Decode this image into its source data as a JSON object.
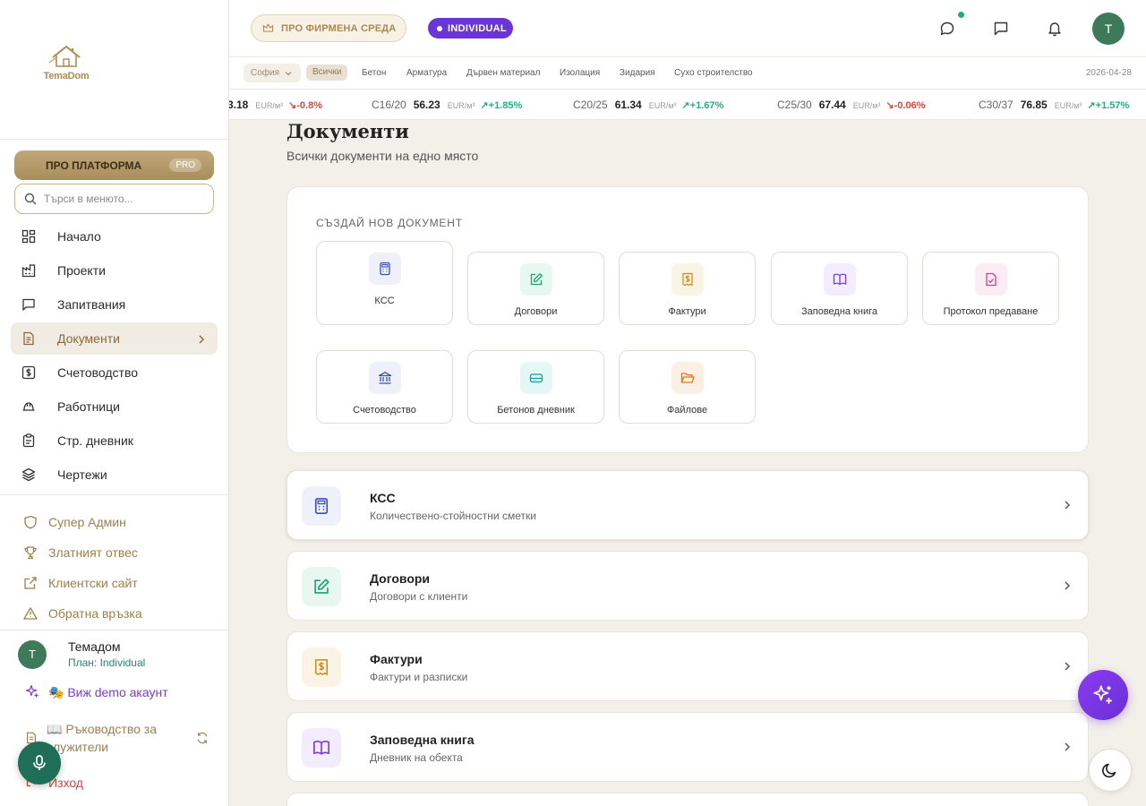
{
  "brand": {
    "name": "TemaDom"
  },
  "sidebar": {
    "pro_button": {
      "label": "ПРО ПЛАТФОРМА",
      "badge": "PRO"
    },
    "search": {
      "placeholder": "Търси в менюто..."
    },
    "items": [
      {
        "label": "Начало",
        "icon": "dashboard-icon"
      },
      {
        "label": "Проекти",
        "icon": "factory-icon"
      },
      {
        "label": "Запитвания",
        "icon": "message-icon"
      },
      {
        "label": "Документи",
        "icon": "document-icon",
        "active": true
      },
      {
        "label": "Счетоводство",
        "icon": "dollar-icon"
      },
      {
        "label": "Работници",
        "icon": "hardhat-icon"
      },
      {
        "label": "Стр. дневник",
        "icon": "clipboard-icon"
      },
      {
        "label": "Чертежи",
        "icon": "layers-icon"
      }
    ],
    "admin_items": [
      {
        "label": "Супер Админ",
        "icon": "shield-icon"
      },
      {
        "label": "Златният отвес",
        "icon": "trophy-icon"
      },
      {
        "label": "Клиентски сайт",
        "icon": "external-link-icon"
      },
      {
        "label": "Обратна връзка",
        "icon": "warning-icon"
      }
    ],
    "user": {
      "initial": "T",
      "name": "Темадом",
      "plan": "План: Individual"
    },
    "demo": "🎭 Виж demo акаунт",
    "guide": "📖 Ръководство за служители",
    "logout": "Изход"
  },
  "topbar": {
    "env_label": "ПРО ФИРМЕНА СРЕДА",
    "plan_label": "INDIVIDUAL",
    "avatar_initial": "T"
  },
  "filters": {
    "city": "София",
    "chips": [
      "Всички",
      "Бетон",
      "Арматура",
      "Дървен материал",
      "Изолация",
      "Зидария",
      "Сухо строителство"
    ],
    "selected": "Всички",
    "date": "2026-04-28"
  },
  "ticker": [
    {
      "name": "",
      "value": "3.18",
      "unit": "EUR/м³",
      "change": "-0.8%",
      "dir": "down"
    },
    {
      "name": "C16/20",
      "value": "56.23",
      "unit": "EUR/м³",
      "change": "+1.85%",
      "dir": "up"
    },
    {
      "name": "C20/25",
      "value": "61.34",
      "unit": "EUR/м³",
      "change": "+1.67%",
      "dir": "up"
    },
    {
      "name": "C25/30",
      "value": "67.44",
      "unit": "EUR/м³",
      "change": "-0.06%",
      "dir": "down"
    },
    {
      "name": "C30/37",
      "value": "76.85",
      "unit": "EUR/м³",
      "change": "+1.57%",
      "dir": "up"
    }
  ],
  "main": {
    "title": "Документи",
    "subtitle": "Всички документи на едно място",
    "create_label": "СЪЗДАЙ НОВ ДОКУМЕНТ",
    "tiles": [
      {
        "label": "КСС",
        "icon": "calculator-icon",
        "color": "#3b4fb8",
        "bg": "#eef0fa"
      },
      {
        "label": "Договори",
        "icon": "edit-icon",
        "color": "#1aa470",
        "bg": "#e8f7f0"
      },
      {
        "label": "Фактури",
        "icon": "receipt-icon",
        "color": "#d08a10",
        "bg": "#fbf3e3"
      },
      {
        "label": "Заповедна книга",
        "icon": "book-icon",
        "color": "#7a3ae0",
        "bg": "#f2ecfc"
      },
      {
        "label": "Протокол предаване",
        "icon": "file-check-icon",
        "color": "#d83c8a",
        "bg": "#fcecf4"
      },
      {
        "label": "Счетоводство",
        "icon": "bank-icon",
        "color": "#3b4fb8",
        "bg": "#eef0fa"
      },
      {
        "label": "Бетонов дневник",
        "icon": "container-icon",
        "color": "#14a0a0",
        "bg": "#e6f6f6"
      },
      {
        "label": "Файлове",
        "icon": "folder-icon",
        "color": "#e07a10",
        "bg": "#fcefe3"
      }
    ],
    "rows": [
      {
        "title": "КСС",
        "subtitle": "Количествено-стойностни сметки",
        "icon": "calculator-icon",
        "color": "#3b4fb8",
        "bg": "#eef0fa"
      },
      {
        "title": "Договори",
        "subtitle": "Договори с клиенти",
        "icon": "edit-icon",
        "color": "#1aa470",
        "bg": "#e8f7f0"
      },
      {
        "title": "Фактури",
        "subtitle": "Фактури и разписки",
        "icon": "receipt-icon",
        "color": "#d08a10",
        "bg": "#fbf3e3"
      },
      {
        "title": "Заповедна книга",
        "subtitle": "Дневник на обекта",
        "icon": "book-icon",
        "color": "#7a3ae0",
        "bg": "#f2ecfc"
      }
    ]
  },
  "colors": {
    "accent": "#a98a55",
    "purple": "#6a35d6",
    "green": "#3d7a5a"
  }
}
